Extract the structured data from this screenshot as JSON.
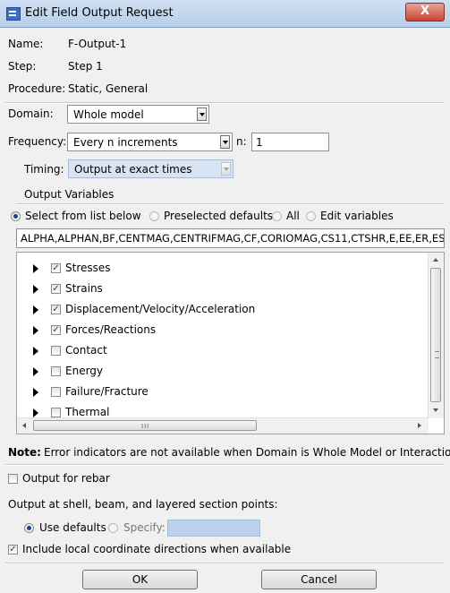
{
  "window": {
    "title": "Edit Field Output Request",
    "close_label": "X"
  },
  "info": {
    "name_label": "Name:",
    "name_value": "F-Output-1",
    "step_label": "Step:",
    "step_value": "Step 1",
    "procedure_label": "Procedure:",
    "procedure_value": "Static, General"
  },
  "domain": {
    "label": "Domain:",
    "value": "Whole model"
  },
  "frequency": {
    "label": "Frequency:",
    "value": "Every n increments",
    "n_label": "n:",
    "n_value": "1"
  },
  "timing": {
    "label": "Timing:",
    "value": "Output at exact times"
  },
  "output_variables": {
    "section_label": "Output Variables",
    "options": [
      {
        "label": "Select from list below",
        "selected": true
      },
      {
        "label": "Preselected defaults",
        "selected": false
      },
      {
        "label": "All",
        "selected": false
      },
      {
        "label": "Edit variables",
        "selected": false
      }
    ],
    "variables_text": "ALPHA,ALPHAN,BF,CENTMAG,CENTRIFMAG,CF,CORIOMAG,CS11,CTSHR,E,EE,ER,ESF",
    "items": [
      {
        "label": "Stresses",
        "checked": true
      },
      {
        "label": "Strains",
        "checked": true
      },
      {
        "label": "Displacement/Velocity/Acceleration",
        "checked": true
      },
      {
        "label": "Forces/Reactions",
        "checked": true
      },
      {
        "label": "Contact",
        "checked": false
      },
      {
        "label": "Energy",
        "checked": false
      },
      {
        "label": "Failure/Fracture",
        "checked": false
      },
      {
        "label": "Thermal",
        "checked": false
      }
    ],
    "hscroll_grip": "III"
  },
  "note": {
    "prefix": "Note:",
    "text": "Error indicators are not available when Domain is Whole Model or Interaction."
  },
  "rebar": {
    "label": "Output for rebar",
    "checked": false
  },
  "section_points": {
    "label": "Output at shell, beam, and layered section points:",
    "use_defaults_label": "Use defaults",
    "specify_label": "Specify:"
  },
  "local_coords": {
    "label": "Include local coordinate directions when available",
    "checked": true
  },
  "buttons": {
    "ok": "OK",
    "cancel": "Cancel"
  },
  "colors": {
    "titlebar": "#c4d7ee",
    "disabled_field": "#bcd1ec",
    "dialog_bg": "#f0f0f0"
  }
}
